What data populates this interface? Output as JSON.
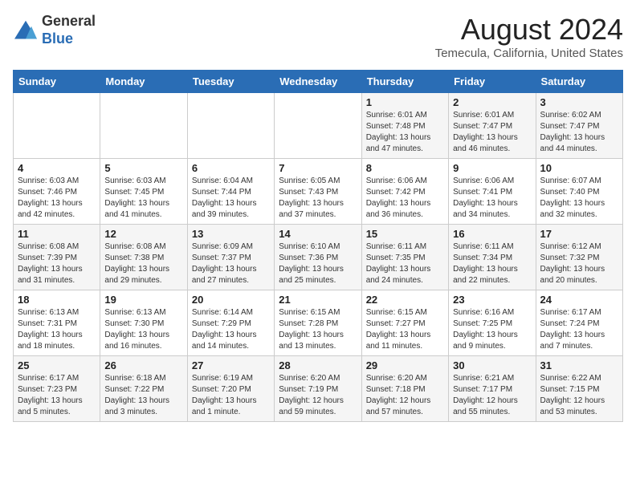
{
  "header": {
    "logo_line1": "General",
    "logo_line2": "Blue",
    "month_title": "August 2024",
    "subtitle": "Temecula, California, United States"
  },
  "weekdays": [
    "Sunday",
    "Monday",
    "Tuesday",
    "Wednesday",
    "Thursday",
    "Friday",
    "Saturday"
  ],
  "weeks": [
    [
      {
        "day": "",
        "info": ""
      },
      {
        "day": "",
        "info": ""
      },
      {
        "day": "",
        "info": ""
      },
      {
        "day": "",
        "info": ""
      },
      {
        "day": "1",
        "info": "Sunrise: 6:01 AM\nSunset: 7:48 PM\nDaylight: 13 hours\nand 47 minutes."
      },
      {
        "day": "2",
        "info": "Sunrise: 6:01 AM\nSunset: 7:47 PM\nDaylight: 13 hours\nand 46 minutes."
      },
      {
        "day": "3",
        "info": "Sunrise: 6:02 AM\nSunset: 7:47 PM\nDaylight: 13 hours\nand 44 minutes."
      }
    ],
    [
      {
        "day": "4",
        "info": "Sunrise: 6:03 AM\nSunset: 7:46 PM\nDaylight: 13 hours\nand 42 minutes."
      },
      {
        "day": "5",
        "info": "Sunrise: 6:03 AM\nSunset: 7:45 PM\nDaylight: 13 hours\nand 41 minutes."
      },
      {
        "day": "6",
        "info": "Sunrise: 6:04 AM\nSunset: 7:44 PM\nDaylight: 13 hours\nand 39 minutes."
      },
      {
        "day": "7",
        "info": "Sunrise: 6:05 AM\nSunset: 7:43 PM\nDaylight: 13 hours\nand 37 minutes."
      },
      {
        "day": "8",
        "info": "Sunrise: 6:06 AM\nSunset: 7:42 PM\nDaylight: 13 hours\nand 36 minutes."
      },
      {
        "day": "9",
        "info": "Sunrise: 6:06 AM\nSunset: 7:41 PM\nDaylight: 13 hours\nand 34 minutes."
      },
      {
        "day": "10",
        "info": "Sunrise: 6:07 AM\nSunset: 7:40 PM\nDaylight: 13 hours\nand 32 minutes."
      }
    ],
    [
      {
        "day": "11",
        "info": "Sunrise: 6:08 AM\nSunset: 7:39 PM\nDaylight: 13 hours\nand 31 minutes."
      },
      {
        "day": "12",
        "info": "Sunrise: 6:08 AM\nSunset: 7:38 PM\nDaylight: 13 hours\nand 29 minutes."
      },
      {
        "day": "13",
        "info": "Sunrise: 6:09 AM\nSunset: 7:37 PM\nDaylight: 13 hours\nand 27 minutes."
      },
      {
        "day": "14",
        "info": "Sunrise: 6:10 AM\nSunset: 7:36 PM\nDaylight: 13 hours\nand 25 minutes."
      },
      {
        "day": "15",
        "info": "Sunrise: 6:11 AM\nSunset: 7:35 PM\nDaylight: 13 hours\nand 24 minutes."
      },
      {
        "day": "16",
        "info": "Sunrise: 6:11 AM\nSunset: 7:34 PM\nDaylight: 13 hours\nand 22 minutes."
      },
      {
        "day": "17",
        "info": "Sunrise: 6:12 AM\nSunset: 7:32 PM\nDaylight: 13 hours\nand 20 minutes."
      }
    ],
    [
      {
        "day": "18",
        "info": "Sunrise: 6:13 AM\nSunset: 7:31 PM\nDaylight: 13 hours\nand 18 minutes."
      },
      {
        "day": "19",
        "info": "Sunrise: 6:13 AM\nSunset: 7:30 PM\nDaylight: 13 hours\nand 16 minutes."
      },
      {
        "day": "20",
        "info": "Sunrise: 6:14 AM\nSunset: 7:29 PM\nDaylight: 13 hours\nand 14 minutes."
      },
      {
        "day": "21",
        "info": "Sunrise: 6:15 AM\nSunset: 7:28 PM\nDaylight: 13 hours\nand 13 minutes."
      },
      {
        "day": "22",
        "info": "Sunrise: 6:15 AM\nSunset: 7:27 PM\nDaylight: 13 hours\nand 11 minutes."
      },
      {
        "day": "23",
        "info": "Sunrise: 6:16 AM\nSunset: 7:25 PM\nDaylight: 13 hours\nand 9 minutes."
      },
      {
        "day": "24",
        "info": "Sunrise: 6:17 AM\nSunset: 7:24 PM\nDaylight: 13 hours\nand 7 minutes."
      }
    ],
    [
      {
        "day": "25",
        "info": "Sunrise: 6:17 AM\nSunset: 7:23 PM\nDaylight: 13 hours\nand 5 minutes."
      },
      {
        "day": "26",
        "info": "Sunrise: 6:18 AM\nSunset: 7:22 PM\nDaylight: 13 hours\nand 3 minutes."
      },
      {
        "day": "27",
        "info": "Sunrise: 6:19 AM\nSunset: 7:20 PM\nDaylight: 13 hours\nand 1 minute."
      },
      {
        "day": "28",
        "info": "Sunrise: 6:20 AM\nSunset: 7:19 PM\nDaylight: 12 hours\nand 59 minutes."
      },
      {
        "day": "29",
        "info": "Sunrise: 6:20 AM\nSunset: 7:18 PM\nDaylight: 12 hours\nand 57 minutes."
      },
      {
        "day": "30",
        "info": "Sunrise: 6:21 AM\nSunset: 7:17 PM\nDaylight: 12 hours\nand 55 minutes."
      },
      {
        "day": "31",
        "info": "Sunrise: 6:22 AM\nSunset: 7:15 PM\nDaylight: 12 hours\nand 53 minutes."
      }
    ]
  ]
}
